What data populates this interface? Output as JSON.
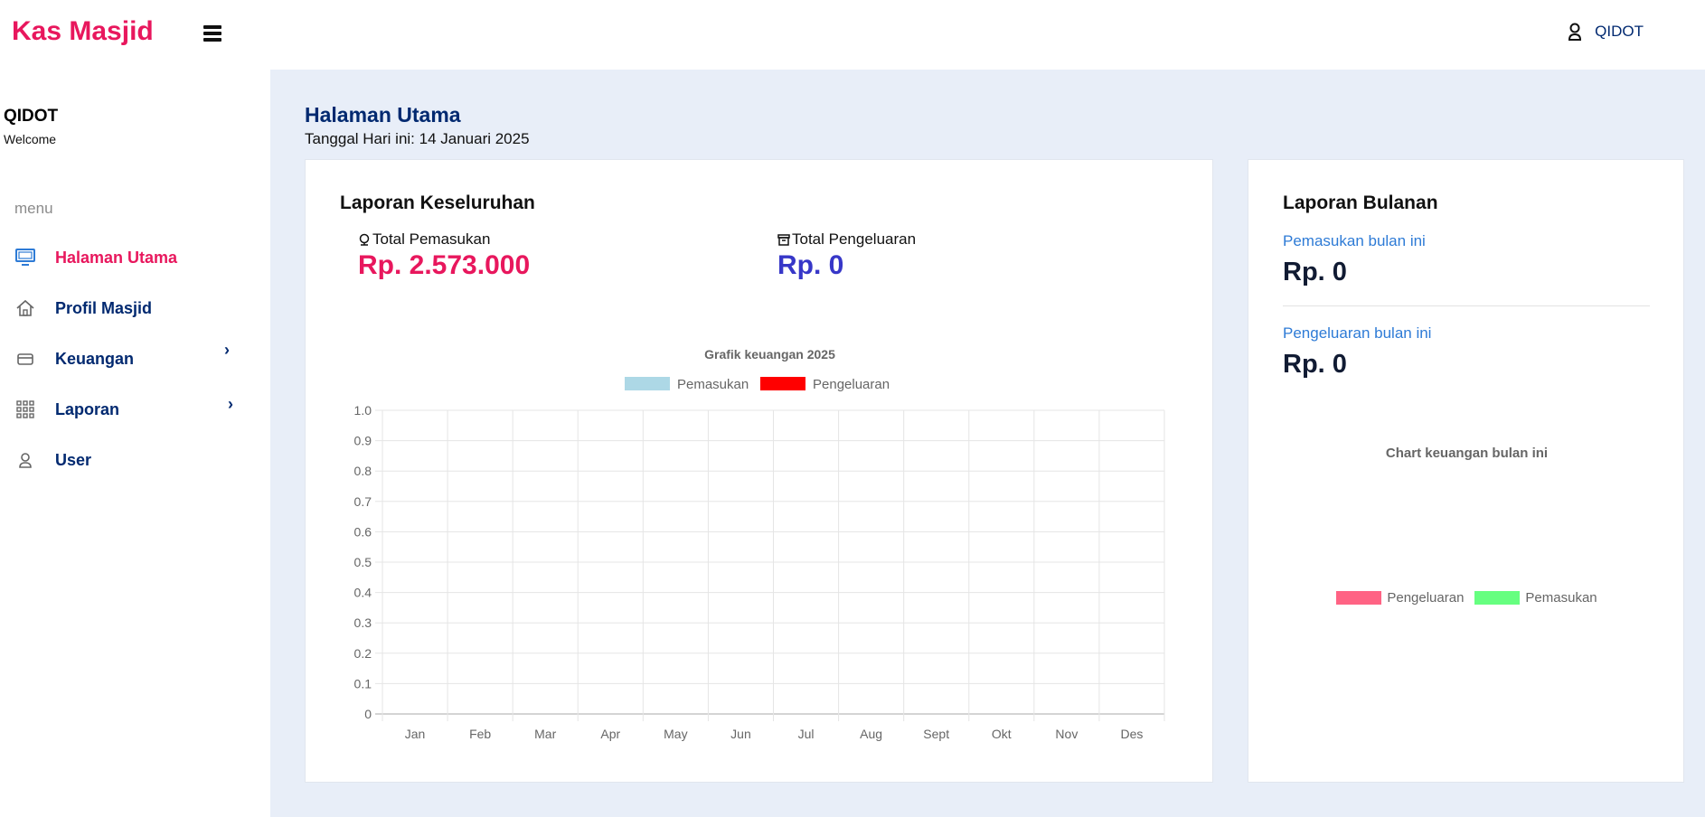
{
  "header": {
    "brand": "Kas Masjid",
    "profile_name": "QIDOT",
    "icons": {
      "menu": "hamburger-icon",
      "profile": "user-icon"
    }
  },
  "sidebar": {
    "user_name": "QIDOT",
    "user_subtitle": "Welcome",
    "menu_heading": "menu",
    "items": [
      {
        "label": "Halaman Utama",
        "icon": "monitor-icon",
        "active": true
      },
      {
        "label": "Profil Masjid",
        "icon": "home-icon"
      },
      {
        "label": "Keuangan",
        "icon": "card-icon",
        "has_submenu": true
      },
      {
        "label": "Laporan",
        "icon": "grid-icon",
        "has_submenu": true
      },
      {
        "label": "User",
        "icon": "user-icon"
      }
    ]
  },
  "page": {
    "title": "Halaman Utama",
    "date_text": "Tanggal Hari ini: 14 Januari 2025"
  },
  "overall": {
    "title": "Laporan Keseluruhan",
    "income_label": "Total Pemasukan",
    "income_value": "Rp. 2.573.000",
    "expense_label": "Total Pengeluaran",
    "expense_value": "Rp. 0"
  },
  "monthly": {
    "title": "Laporan Bulanan",
    "income_label": "Pemasukan bulan ini",
    "income_value": "Rp. 0",
    "expense_label": "Pengeluaran bulan ini",
    "expense_value": "Rp. 0",
    "chart_title": "Chart keuangan bulan ini",
    "legend": [
      {
        "label": "Pengeluaran",
        "color": "#ff6384"
      },
      {
        "label": "Pemasukan",
        "color": "#66ff80"
      }
    ]
  },
  "colors": {
    "brand": "#e8175d",
    "navy": "#012970",
    "income_blue": "#add8e6",
    "expense_red": "#ff0000"
  },
  "chart_data": [
    {
      "type": "bar",
      "title": "Grafik keuangan 2025",
      "categories": [
        "Jan",
        "Feb",
        "Mar",
        "Apr",
        "May",
        "Jun",
        "Jul",
        "Aug",
        "Sept",
        "Okt",
        "Nov",
        "Des"
      ],
      "series": [
        {
          "name": "Pemasukan",
          "color": "#add8e6",
          "values": [
            0,
            0,
            0,
            0,
            0,
            0,
            0,
            0,
            0,
            0,
            0,
            0
          ]
        },
        {
          "name": "Pengeluaran",
          "color": "#ff0000",
          "values": [
            0,
            0,
            0,
            0,
            0,
            0,
            0,
            0,
            0,
            0,
            0,
            0
          ]
        }
      ],
      "ylim": [
        0,
        1
      ],
      "yticks": [
        "0",
        "0.1",
        "0.2",
        "0.3",
        "0.4",
        "0.5",
        "0.6",
        "0.7",
        "0.8",
        "0.9",
        "1.0"
      ],
      "grid": true,
      "legend": "top"
    },
    {
      "type": "pie",
      "title": "Chart keuangan bulan ini",
      "categories": [
        "Pengeluaran",
        "Pemasukan"
      ],
      "values": [
        0,
        0
      ],
      "colors": [
        "#ff6384",
        "#66ff80"
      ],
      "legend": "bottom"
    }
  ]
}
